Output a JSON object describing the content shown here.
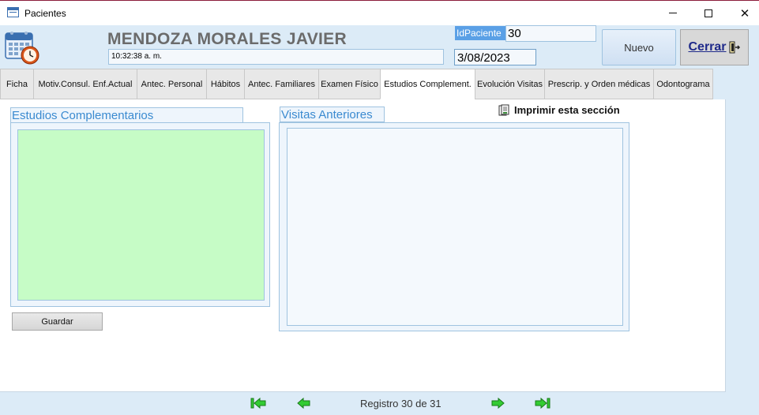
{
  "window": {
    "title": "Pacientes",
    "minimize_icon": "minimize-icon",
    "maximize_icon": "maximize-icon",
    "close_glyph": "✕"
  },
  "header": {
    "patient_name": "MENDOZA MORALES JAVIER",
    "time": "10:32:38 a. m.",
    "id_label": "IdPaciente",
    "id_value": "30",
    "date": "3/08/2023",
    "new_button": "Nuevo",
    "close_button": "Cerrar"
  },
  "tabs": [
    {
      "label": "Ficha"
    },
    {
      "label": "Motiv.Consul. Enf.Actual"
    },
    {
      "label": "Antec. Personal"
    },
    {
      "label": "Hábitos"
    },
    {
      "label": "Antec. Familiares"
    },
    {
      "label": "Examen Físico"
    },
    {
      "label": "Estudios Complement."
    },
    {
      "label": "Evolución Visitas"
    },
    {
      "label": "Prescrip. y Orden médicas"
    },
    {
      "label": "Odontograma"
    }
  ],
  "active_tab": "Estudios Complement.",
  "content": {
    "estudios_label": "Estudios Complementarios",
    "visitas_label": "Visitas Anteriores",
    "print_label": "Imprimir esta sección",
    "save_button": "Guardar"
  },
  "navigation": {
    "record_text": "Registro 30 de 31",
    "current": 30,
    "total": 31
  },
  "colors": {
    "background": "#dcebf7",
    "accent_blue": "#3a8ad0",
    "id_label_bg": "#5aa0e6",
    "estudios_field": "#c6fcc6",
    "nav_arrow_green": "#33cc33",
    "close_text": "#1f2a8a"
  }
}
